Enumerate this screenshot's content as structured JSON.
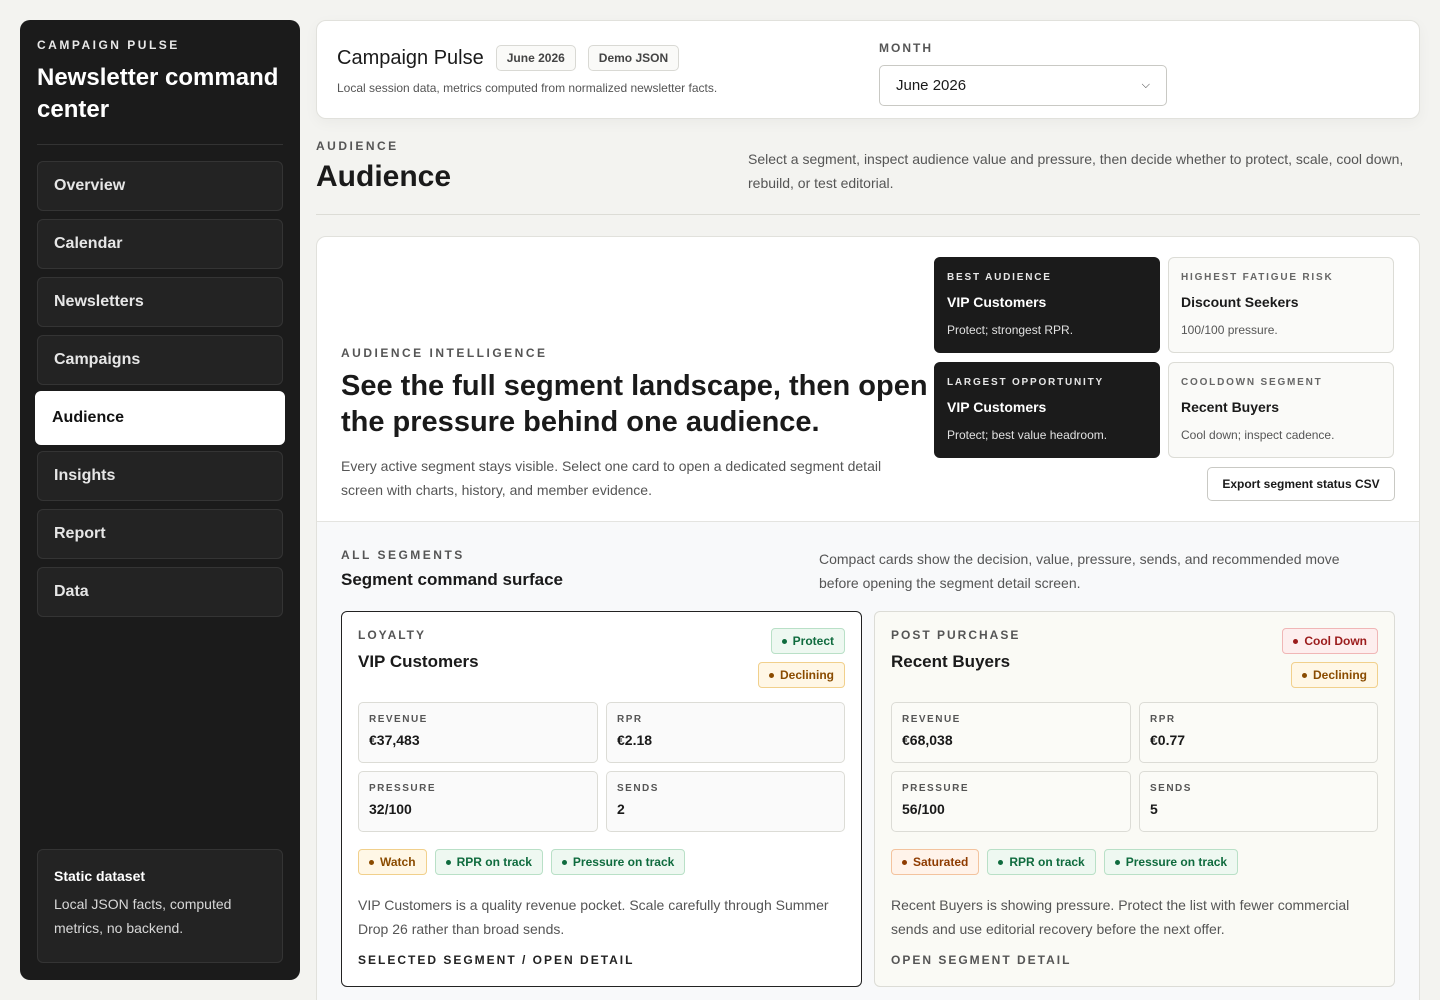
{
  "sidebar": {
    "eyebrow": "CAMPAIGN PULSE",
    "title": "Newsletter command center",
    "nav": [
      "Overview",
      "Calendar",
      "Newsletters",
      "Campaigns",
      "Audience",
      "Insights",
      "Report",
      "Data"
    ],
    "active": "Audience",
    "footer": {
      "title": "Static dataset",
      "text": "Local JSON facts, computed metrics, no backend."
    }
  },
  "topbar": {
    "title": "Campaign Pulse",
    "pill_month": "June 2026",
    "pill_data": "Demo JSON",
    "subtitle": "Local session data, metrics computed from normalized newsletter facts.",
    "month_label": "MONTH",
    "month_value": "June 2026"
  },
  "page": {
    "eyebrow": "AUDIENCE",
    "title": "Audience",
    "description": "Select a segment, inspect audience value and pressure, then decide whether to protect, scale, cool down, rebuild, or test editorial."
  },
  "hero": {
    "eyebrow": "AUDIENCE INTELLIGENCE",
    "title": "See the full segment landscape, then open the pressure behind one audience.",
    "description": "Every active segment stays visible. Select one card to open a dedicated segment detail screen with charts, history, and member evidence."
  },
  "stat_cards": [
    {
      "eyebrow": "BEST AUDIENCE",
      "title": "VIP Customers",
      "text": "Protect; strongest RPR."
    },
    {
      "eyebrow": "HIGHEST FATIGUE RISK",
      "title": "Discount Seekers",
      "text": "100/100 pressure."
    },
    {
      "eyebrow": "LARGEST OPPORTUNITY",
      "title": "VIP Customers",
      "text": "Protect; best value headroom."
    },
    {
      "eyebrow": "COOLDOWN SEGMENT",
      "title": "Recent Buyers",
      "text": "Cool down; inspect cadence."
    }
  ],
  "export_label": "Export segment status CSV",
  "segments_section": {
    "eyebrow": "ALL SEGMENTS",
    "title": "Segment command surface",
    "description": "Compact cards show the decision, value, pressure, sends, and recommended move before opening the segment detail screen."
  },
  "segments": [
    {
      "eyebrow": "LOYALTY",
      "title": "VIP Customers",
      "decision": "Protect",
      "trend": "Declining",
      "metrics": {
        "revenue_label": "REVENUE",
        "revenue": "€37,483",
        "rpr_label": "RPR",
        "rpr": "€2.18",
        "pressure_label": "PRESSURE",
        "pressure": "32/100",
        "sends_label": "SENDS",
        "sends": "2"
      },
      "tags": [
        "Watch",
        "RPR on track",
        "Pressure on track"
      ],
      "text": "VIP Customers is a quality revenue pocket. Scale carefully through Summer Drop 26 rather than broad sends.",
      "cta": "SELECTED SEGMENT / OPEN DETAIL"
    },
    {
      "eyebrow": "POST PURCHASE",
      "title": "Recent Buyers",
      "decision": "Cool Down",
      "trend": "Declining",
      "metrics": {
        "revenue_label": "REVENUE",
        "revenue": "€68,038",
        "rpr_label": "RPR",
        "rpr": "€0.77",
        "pressure_label": "PRESSURE",
        "pressure": "56/100",
        "sends_label": "SENDS",
        "sends": "5"
      },
      "tags": [
        "Saturated",
        "RPR on track",
        "Pressure on track"
      ],
      "text": "Recent Buyers is showing pressure. Protect the list with fewer commercial sends and use editorial recovery before the next offer.",
      "cta": "OPEN SEGMENT DETAIL"
    }
  ],
  "icons": {
    "select": "chevron-down-icon",
    "badge": "dot-icon"
  },
  "colors": {
    "sidebar_bg": "#1b1b1b",
    "green": "#0f6b3e",
    "amber": "#8a4b00",
    "red": "#9b1c1c"
  }
}
